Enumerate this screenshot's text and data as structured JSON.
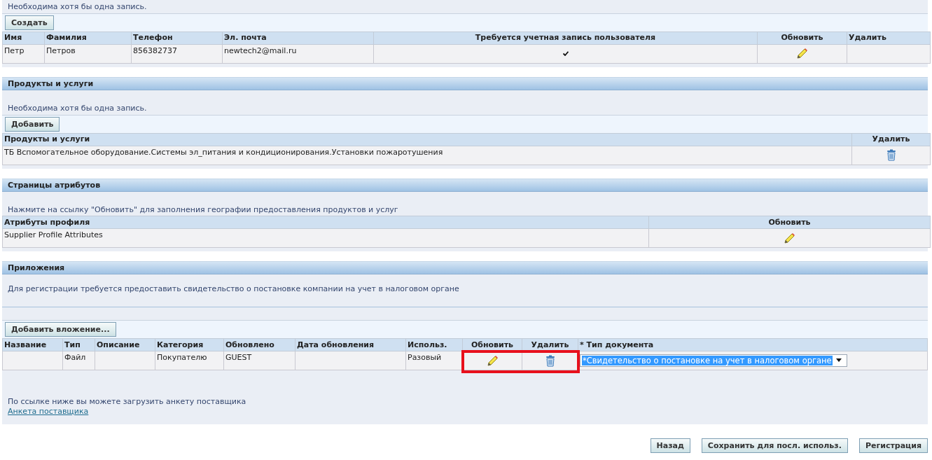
{
  "sections": [
    {
      "message": "Необходима хотя бы одна запись.",
      "button": "Создать",
      "table": {
        "columns": [
          {
            "label": "Имя"
          },
          {
            "label": "Фамилия"
          },
          {
            "label": "Телефон"
          },
          {
            "label": "Эл. почта"
          },
          {
            "label": "Требуется учетная запись пользователя"
          },
          {
            "label": "Обновить"
          },
          {
            "label": "Удалить"
          }
        ],
        "rows": [
          [
            {
              "kind": "text",
              "text": "Петр"
            },
            {
              "kind": "text",
              "text": "Петров"
            },
            {
              "kind": "text",
              "text": "856382737"
            },
            {
              "kind": "text",
              "text": "newtech2@mail.ru"
            },
            {
              "kind": "check",
              "checked": true
            },
            {
              "kind": "edit"
            },
            {
              "kind": "empty"
            }
          ]
        ]
      }
    },
    {
      "title": "Продукты и услуги",
      "message": "Необходима хотя бы одна запись.",
      "button": "Добавить",
      "table": {
        "columns": [
          {
            "label": "Продукты и услуги"
          },
          {
            "label": "Удалить"
          }
        ],
        "rows": [
          [
            {
              "kind": "text",
              "text": "ТБ Вспомогательное оборудование.Системы эл_питания и кондиционирования.Установки пожаротушения"
            },
            {
              "kind": "delete"
            }
          ]
        ]
      }
    },
    {
      "title": "Страницы атрибутов",
      "message": "Нажмите на ссылку \"Обновить\" для заполнения географии предоставления продуктов и услуг",
      "table": {
        "columns": [
          {
            "label": "Атрибуты профиля"
          },
          {
            "label": "Обновить"
          }
        ],
        "rows": [
          [
            {
              "kind": "text",
              "text": "Supplier Profile Attributes"
            },
            {
              "kind": "edit"
            }
          ]
        ]
      }
    },
    {
      "title": "Приложения",
      "message": "Для регистрации требуется предоставить свидетельство о постановке компании на учет в налоговом органе",
      "button": "Добавить вложение...",
      "table": {
        "columns": [
          {
            "label": "Название"
          },
          {
            "label": "Тип"
          },
          {
            "label": "Описание"
          },
          {
            "label": "Категория"
          },
          {
            "label": "Обновлено"
          },
          {
            "label": "Дата обновления"
          },
          {
            "label": "Использ."
          },
          {
            "label": "Обновить"
          },
          {
            "label": "Удалить"
          },
          {
            "label": "* Тип документа"
          }
        ],
        "rows": [
          [
            {
              "kind": "empty"
            },
            {
              "kind": "text",
              "text": "Файл"
            },
            {
              "kind": "empty"
            },
            {
              "kind": "text",
              "text": "Покупателю"
            },
            {
              "kind": "text",
              "text": "GUEST"
            },
            {
              "kind": "empty"
            },
            {
              "kind": "text",
              "text": "Разовый"
            },
            {
              "kind": "edit",
              "highlighted": true
            },
            {
              "kind": "delete",
              "highlighted": true
            },
            {
              "kind": "select",
              "value": "*Свидетельство о постановке на учет в налоговом органе"
            }
          ]
        ]
      },
      "footer_text": "По ссылке ниже вы можете загрузить анкету поставщика",
      "footer_link": "Анкета поставщика"
    }
  ],
  "actions": [
    "Назад",
    "Сохранить для посл. использ.",
    "Регистрация"
  ]
}
